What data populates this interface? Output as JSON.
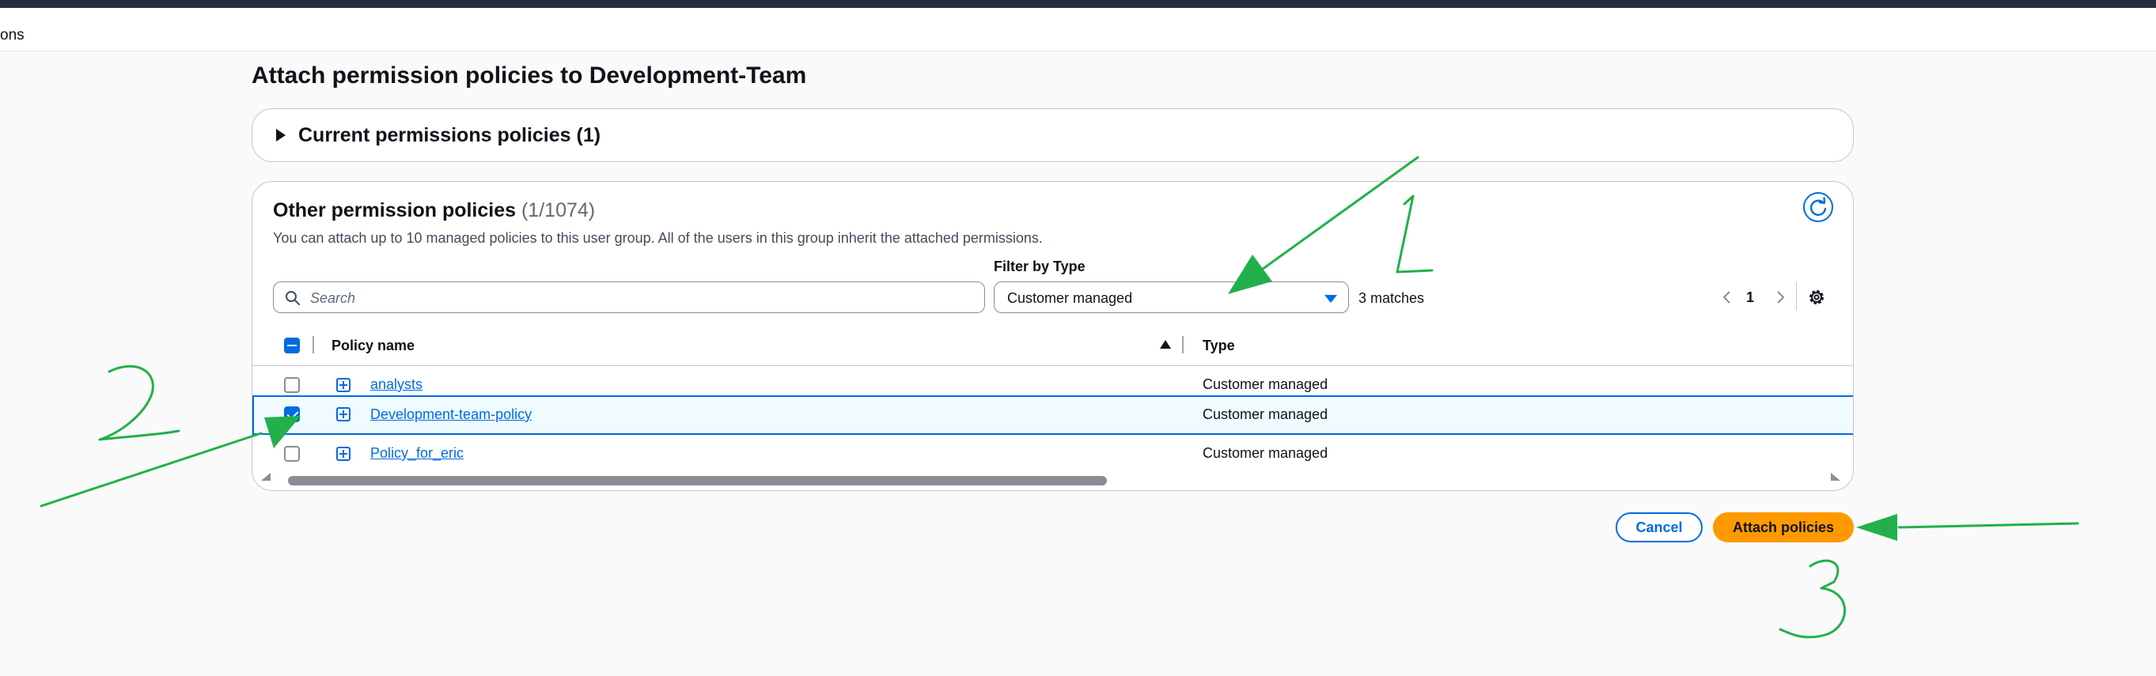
{
  "breadcrumb": {
    "fragment": "ons"
  },
  "page": {
    "title": "Attach permission policies to Development-Team"
  },
  "current_policies": {
    "title": "Current permissions policies (1)"
  },
  "other_policies": {
    "title": "Other permission policies",
    "count": "(1/1074)",
    "description": "You can attach up to 10 managed policies to this user group. All of the users in this group inherit the attached permissions."
  },
  "search": {
    "placeholder": "Search",
    "value": ""
  },
  "filter": {
    "label": "Filter by Type",
    "value": "Customer managed"
  },
  "results": {
    "matches": "3 matches"
  },
  "pagination": {
    "current_page": "1"
  },
  "table": {
    "headers": {
      "policy_name": "Policy name",
      "type": "Type"
    },
    "rows": [
      {
        "name": "analysts",
        "type": "Customer managed",
        "checked": false
      },
      {
        "name": "Development-team-policy",
        "type": "Customer managed",
        "checked": true
      },
      {
        "name": "Policy_for_eric",
        "type": "Customer managed",
        "checked": false
      }
    ]
  },
  "actions": {
    "cancel": "Cancel",
    "attach": "Attach policies"
  },
  "colors": {
    "accent": "#006ce0",
    "primary_button": "#ff9900",
    "annotation": "#22b04b",
    "selected_row_bg": "#f0fbff"
  },
  "icons": [
    "search-icon",
    "refresh-icon",
    "chevron-left-icon",
    "chevron-right-icon",
    "settings-icon",
    "expand-icon",
    "caret-right-icon",
    "sort-ascending-icon"
  ]
}
